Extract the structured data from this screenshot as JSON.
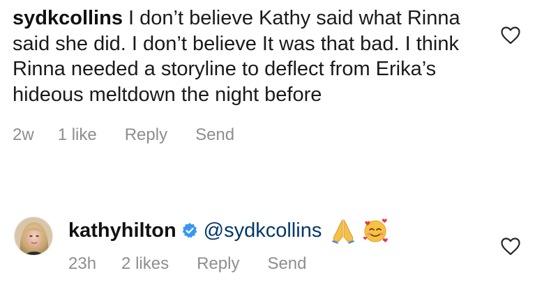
{
  "comments": [
    {
      "username": "sydkcollins",
      "text": "I don’t believe Kathy said what Rinna said she did. I don’t believe It was that bad. I think Rinna needed a storyline to deflect from Erika’s hideous meltdown the night before",
      "time": "2w",
      "likes": "1 like",
      "reply_label": "Reply",
      "send_label": "Send",
      "icons": {
        "like": "heart-outline-icon"
      }
    }
  ],
  "replies": [
    {
      "username": "kathyhilton",
      "verified": true,
      "mention": "@sydkcollins",
      "emojis": [
        "folded-hands-emoji",
        "smiling-face-with-hearts-emoji"
      ],
      "time": "23h",
      "likes": "2 likes",
      "reply_label": "Reply",
      "send_label": "Send",
      "icons": {
        "like": "heart-outline-icon",
        "verified": "verified-badge-icon",
        "avatar": "profile-photo"
      },
      "colors": {
        "verified": "#3897f0",
        "mention": "#00376b"
      }
    }
  ],
  "colors": {
    "meta_text": "#8e8e8e",
    "body_text": "#1a1a1a"
  }
}
